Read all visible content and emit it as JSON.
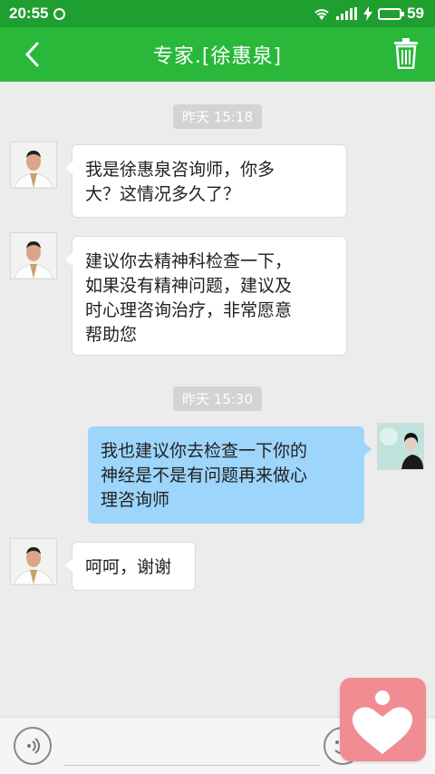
{
  "status_bar": {
    "time": "20:55",
    "battery": "59"
  },
  "header": {
    "title": "专家.[徐惠泉]",
    "back_icon": "chevron-left-icon",
    "trash_icon": "trash-icon"
  },
  "messages": [
    {
      "type": "timestamp",
      "text": "昨天 15:18"
    },
    {
      "type": "message",
      "from": "expert",
      "text": "我是徐惠泉咨询师，你多\n大？这情况多久了？"
    },
    {
      "type": "message",
      "from": "expert",
      "text": "建议你去精神科检查一下，\n如果没有精神问题，建议及\n时心理咨询治疗，非常愿意\n帮助您"
    },
    {
      "type": "timestamp",
      "text": "昨天 15:30"
    },
    {
      "type": "message",
      "from": "me",
      "text": "我也建议你去检查一下你的\n神经是不是有问题再来做心\n理咨询师"
    },
    {
      "type": "message",
      "from": "expert",
      "text": "呵呵，谢谢"
    }
  ],
  "input_bar": {
    "placeholder": "",
    "voice_icon": "voice-icon",
    "emoji_icon": "emoji-icon"
  },
  "colors": {
    "header_green": "#29b83a",
    "status_green": "#1f9f2f",
    "my_bubble": "#9dd5fb",
    "fab_pink": "#f18d92"
  }
}
